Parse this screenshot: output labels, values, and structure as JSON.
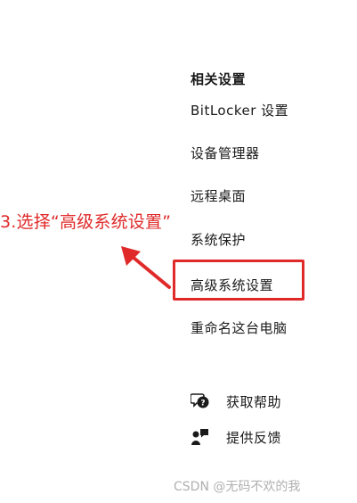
{
  "related_settings": {
    "title": "相关设置",
    "links": [
      {
        "label": "BitLocker 设置"
      },
      {
        "label": "设备管理器"
      },
      {
        "label": "远程桌面"
      },
      {
        "label": "系统保护"
      },
      {
        "label": "高级系统设置"
      },
      {
        "label": "重命名这台电脑"
      }
    ]
  },
  "annotation": {
    "text": "3.选择“高级系统设置”",
    "color": "#e02a2a"
  },
  "help": {
    "get_help": {
      "label": "获取帮助",
      "icon": "chat-help-icon"
    },
    "feedback": {
      "label": "提供反馈",
      "icon": "feedback-person-icon"
    }
  },
  "watermark": "CSDN @无码不欢的我"
}
